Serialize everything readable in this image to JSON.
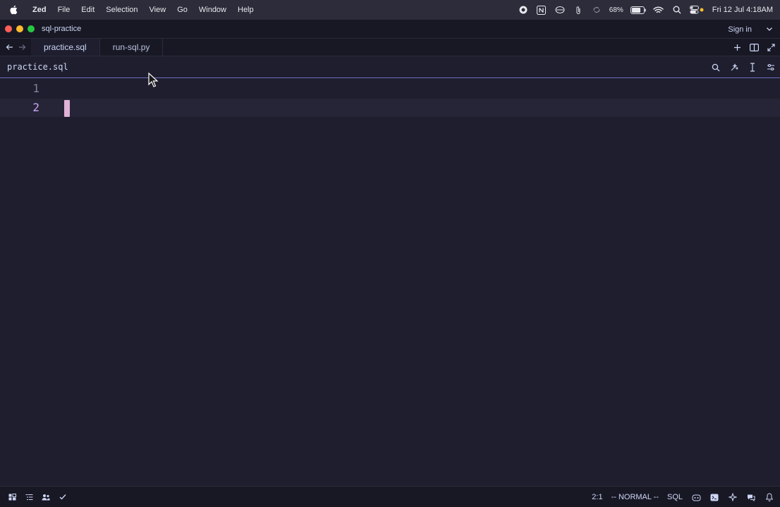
{
  "menubar": {
    "app_name": "Zed",
    "items": [
      "File",
      "Edit",
      "Selection",
      "View",
      "Go",
      "Window",
      "Help"
    ],
    "battery": "68%",
    "clock": "Fri 12 Jul  4:18AM"
  },
  "titlebar": {
    "project": "sql-practice",
    "signin": "Sign in"
  },
  "tabs": [
    {
      "label": "practice.sql",
      "active": true
    },
    {
      "label": "run-sql.py",
      "active": false
    }
  ],
  "toolbar": {
    "breadcrumb": "practice.sql"
  },
  "editor": {
    "lines": [
      {
        "number": "1",
        "text": ""
      },
      {
        "number": "2",
        "text": ""
      }
    ],
    "current_line": 2
  },
  "statusbar": {
    "cursor_position": "2:1",
    "mode": "-- NORMAL --",
    "language": "SQL"
  },
  "colors": {
    "background": "#1e1e2e",
    "cursor": "#f5c2e7",
    "current_line_number": "#cba6f7",
    "accent_border": "#6c6fbf"
  }
}
